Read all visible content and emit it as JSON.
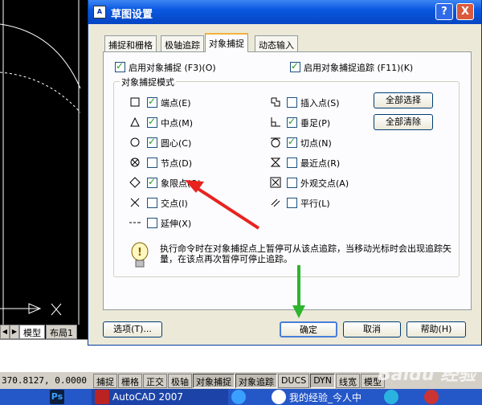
{
  "dialog": {
    "title": "草图设置",
    "help_glyph": "?",
    "close_glyph": "X",
    "tabs": [
      "捕捉和栅格",
      "极轴追踪",
      "对象捕捉",
      "动态输入"
    ],
    "active_tab": 2,
    "enable_osnap": {
      "label": "启用对象捕捉 (F3)(O)",
      "checked": true
    },
    "enable_tracking": {
      "label": "启用对象捕捉追踪 (F11)(K)",
      "checked": true
    },
    "group_title": "对象捕捉模式",
    "modes_left": [
      {
        "label": "端点(E)",
        "checked": true,
        "icon": "square-marker-icon"
      },
      {
        "label": "中点(M)",
        "checked": true,
        "icon": "triangle-marker-icon"
      },
      {
        "label": "圆心(C)",
        "checked": true,
        "icon": "circle-marker-icon"
      },
      {
        "label": "节点(D)",
        "checked": false,
        "icon": "node-marker-icon"
      },
      {
        "label": "象限点(Q)",
        "checked": true,
        "icon": "diamond-marker-icon"
      },
      {
        "label": "交点(I)",
        "checked": false,
        "icon": "x-marker-icon"
      },
      {
        "label": "延伸(X)",
        "checked": false,
        "icon": "extension-marker-icon"
      }
    ],
    "modes_right": [
      {
        "label": "插入点(S)",
        "checked": false,
        "icon": "insert-marker-icon"
      },
      {
        "label": "垂足(P)",
        "checked": true,
        "icon": "perpendicular-marker-icon"
      },
      {
        "label": "切点(N)",
        "checked": true,
        "icon": "tangent-marker-icon"
      },
      {
        "label": "最近点(R)",
        "checked": false,
        "icon": "nearest-marker-icon"
      },
      {
        "label": "外观交点(A)",
        "checked": false,
        "icon": "apparent-intersection-icon"
      },
      {
        "label": "平行(L)",
        "checked": false,
        "icon": "parallel-marker-icon"
      }
    ],
    "select_all": "全部选择",
    "clear_all": "全部清除",
    "info_text": "执行命令时在对象捕捉点上暂停可从该点追踪，当移动光标时会出现追踪矢量，在该点再次暂停可停止追踪。",
    "options_button": "选项(T)...",
    "ok_button": "确定",
    "cancel_button": "取消",
    "help_button": "帮助(H)"
  },
  "layout_tabs": {
    "nav": [
      "◀",
      "▶"
    ],
    "tabs": [
      "模型",
      "布局1"
    ]
  },
  "status_bar": {
    "coords": "370.8127, 0.0000",
    "buttons": [
      {
        "label": "捕捉",
        "on": false
      },
      {
        "label": "栅格",
        "on": false
      },
      {
        "label": "正交",
        "on": false
      },
      {
        "label": "极轴",
        "on": false
      },
      {
        "label": "对象捕捉",
        "on": true
      },
      {
        "label": "对象追踪",
        "on": true
      },
      {
        "label": "DUCS",
        "on": false
      },
      {
        "label": "DYN",
        "on": true
      },
      {
        "label": "线宽",
        "on": false
      },
      {
        "label": "模型",
        "on": false
      }
    ]
  },
  "taskbar": {
    "ps_label": "Ps",
    "autocad_label": "AutoCAD 2007",
    "browser_label": "我的经验_今人中"
  },
  "watermark": "Baidu 经验",
  "colors": {
    "annotation_arrow_red": "#e8231e",
    "annotation_arrow_green": "#2db52d",
    "title_blue": "#0a58e0"
  }
}
